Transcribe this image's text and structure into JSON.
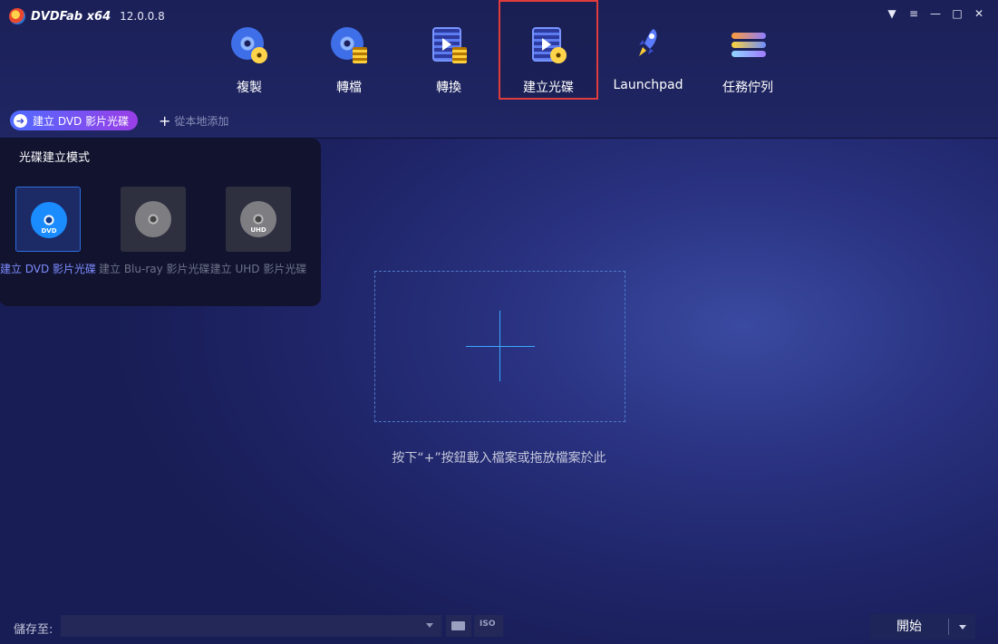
{
  "app": {
    "brand": "DVDFab x64",
    "version": "12.0.0.8"
  },
  "nav": [
    {
      "label": "複製",
      "icon": "disc-copy-icon"
    },
    {
      "label": "轉檔",
      "icon": "disc-ripper-icon"
    },
    {
      "label": "轉換",
      "icon": "video-converter-icon"
    },
    {
      "label": "建立光碟",
      "icon": "disc-creator-icon",
      "active": true
    },
    {
      "label": "Launchpad",
      "icon": "rocket-icon"
    },
    {
      "label": "任務佇列",
      "icon": "task-queue-icon"
    }
  ],
  "subbar": {
    "mode_label": "建立 DVD 影片光碟",
    "add_label": "從本地添加"
  },
  "panel": {
    "title": "光碟建立模式",
    "modes": [
      {
        "label": "建立 DVD 影片光碟",
        "disc_text": "DVD",
        "active": true
      },
      {
        "label": "建立 Blu-ray 影片光碟",
        "disc_text": "",
        "active": false
      },
      {
        "label": "建立 UHD 影片光碟",
        "disc_text": "UHD",
        "active": false
      }
    ]
  },
  "dropzone": {
    "hint": "按下“+”按鈕載入檔案或拖放檔案於此"
  },
  "bottom": {
    "save_label": "儲存至:",
    "save_value": "",
    "iso_label": "ISO",
    "start_label": "開始"
  },
  "colors": {
    "accent": "#4f6bff",
    "active_outline": "#e13c3c",
    "background": "#1e2466"
  }
}
